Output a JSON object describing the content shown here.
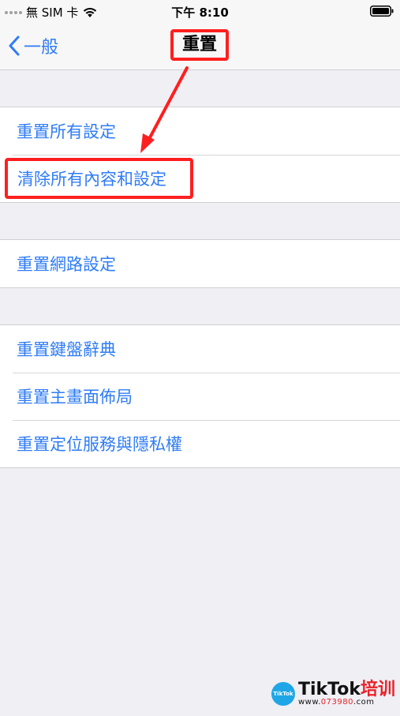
{
  "status_bar": {
    "carrier": "無 SIM 卡",
    "time": "下午 8:10"
  },
  "nav": {
    "back_label": "一般",
    "title": "重置"
  },
  "groups": [
    {
      "items": [
        {
          "label": "重置所有設定",
          "highlighted": false
        },
        {
          "label": "清除所有內容和設定",
          "highlighted": true
        }
      ]
    },
    {
      "items": [
        {
          "label": "重置網路設定",
          "highlighted": false
        }
      ]
    },
    {
      "items": [
        {
          "label": "重置鍵盤辭典",
          "highlighted": false
        },
        {
          "label": "重置主畫面佈局",
          "highlighted": false
        },
        {
          "label": "重置定位服務與隱私權",
          "highlighted": false
        }
      ]
    }
  ],
  "watermark": {
    "logo_text": "TikTok",
    "brand": "TikTok",
    "brand_accent": "培训",
    "url_prefix": "www.",
    "url_number": "073980",
    "url_suffix": ".com"
  },
  "colors": {
    "link_blue": "#2f7cf6",
    "annotation_red": "#ff1f1f",
    "background": "#efeff4"
  }
}
